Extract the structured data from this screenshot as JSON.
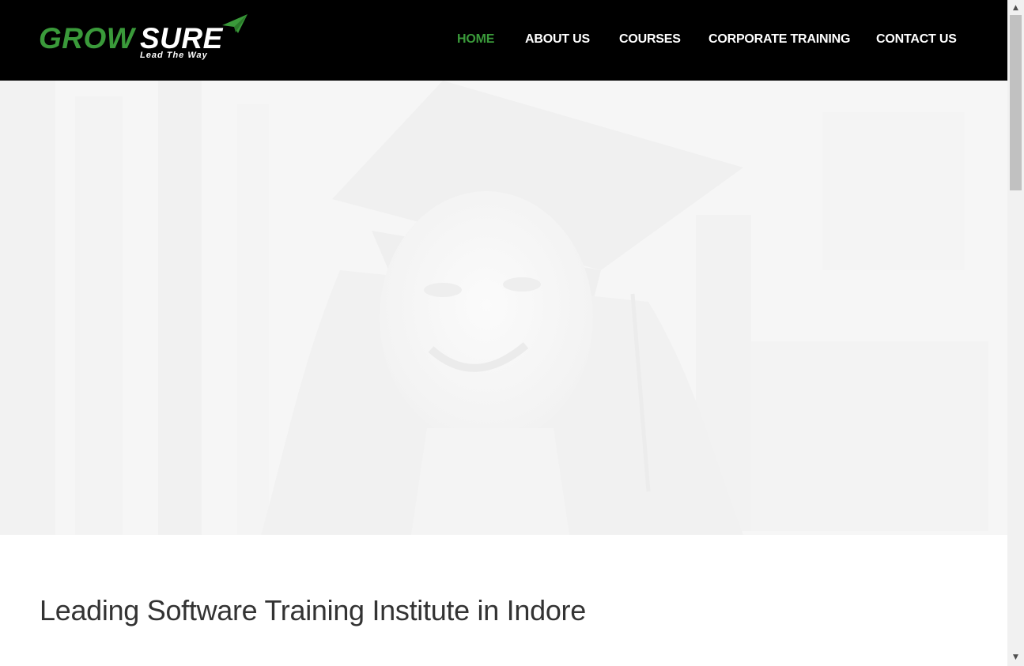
{
  "brand": {
    "name_part1": "GROW",
    "name_part2": "SURE",
    "tagline": "Lead The Way",
    "accent_color": "#3a9a3a"
  },
  "nav": {
    "items": [
      {
        "label": "HOME",
        "active": true
      },
      {
        "label": "ABOUT US",
        "active": false
      },
      {
        "label": "COURSES",
        "active": false
      },
      {
        "label": "CORPORATE TRAINING",
        "active": false
      },
      {
        "label": "CONTACT US",
        "active": false
      }
    ]
  },
  "hero": {
    "image": "graduate-in-cap-faded-photo"
  },
  "main": {
    "heading": "Leading Software Training Institute in Indore"
  },
  "scrollbar": {
    "up_icon": "arrow-up-icon",
    "down_icon": "arrow-down-icon"
  }
}
